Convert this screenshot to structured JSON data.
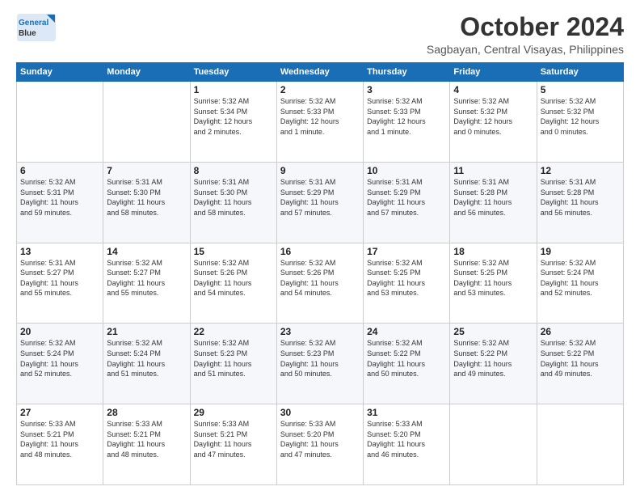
{
  "header": {
    "logo_line1": "General",
    "logo_line2": "Blue",
    "month": "October 2024",
    "location": "Sagbayan, Central Visayas, Philippines"
  },
  "weekdays": [
    "Sunday",
    "Monday",
    "Tuesday",
    "Wednesday",
    "Thursday",
    "Friday",
    "Saturday"
  ],
  "weeks": [
    [
      {
        "day": "",
        "info": ""
      },
      {
        "day": "",
        "info": ""
      },
      {
        "day": "1",
        "info": "Sunrise: 5:32 AM\nSunset: 5:34 PM\nDaylight: 12 hours\nand 2 minutes."
      },
      {
        "day": "2",
        "info": "Sunrise: 5:32 AM\nSunset: 5:33 PM\nDaylight: 12 hours\nand 1 minute."
      },
      {
        "day": "3",
        "info": "Sunrise: 5:32 AM\nSunset: 5:33 PM\nDaylight: 12 hours\nand 1 minute."
      },
      {
        "day": "4",
        "info": "Sunrise: 5:32 AM\nSunset: 5:32 PM\nDaylight: 12 hours\nand 0 minutes."
      },
      {
        "day": "5",
        "info": "Sunrise: 5:32 AM\nSunset: 5:32 PM\nDaylight: 12 hours\nand 0 minutes."
      }
    ],
    [
      {
        "day": "6",
        "info": "Sunrise: 5:32 AM\nSunset: 5:31 PM\nDaylight: 11 hours\nand 59 minutes."
      },
      {
        "day": "7",
        "info": "Sunrise: 5:31 AM\nSunset: 5:30 PM\nDaylight: 11 hours\nand 58 minutes."
      },
      {
        "day": "8",
        "info": "Sunrise: 5:31 AM\nSunset: 5:30 PM\nDaylight: 11 hours\nand 58 minutes."
      },
      {
        "day": "9",
        "info": "Sunrise: 5:31 AM\nSunset: 5:29 PM\nDaylight: 11 hours\nand 57 minutes."
      },
      {
        "day": "10",
        "info": "Sunrise: 5:31 AM\nSunset: 5:29 PM\nDaylight: 11 hours\nand 57 minutes."
      },
      {
        "day": "11",
        "info": "Sunrise: 5:31 AM\nSunset: 5:28 PM\nDaylight: 11 hours\nand 56 minutes."
      },
      {
        "day": "12",
        "info": "Sunrise: 5:31 AM\nSunset: 5:28 PM\nDaylight: 11 hours\nand 56 minutes."
      }
    ],
    [
      {
        "day": "13",
        "info": "Sunrise: 5:31 AM\nSunset: 5:27 PM\nDaylight: 11 hours\nand 55 minutes."
      },
      {
        "day": "14",
        "info": "Sunrise: 5:32 AM\nSunset: 5:27 PM\nDaylight: 11 hours\nand 55 minutes."
      },
      {
        "day": "15",
        "info": "Sunrise: 5:32 AM\nSunset: 5:26 PM\nDaylight: 11 hours\nand 54 minutes."
      },
      {
        "day": "16",
        "info": "Sunrise: 5:32 AM\nSunset: 5:26 PM\nDaylight: 11 hours\nand 54 minutes."
      },
      {
        "day": "17",
        "info": "Sunrise: 5:32 AM\nSunset: 5:25 PM\nDaylight: 11 hours\nand 53 minutes."
      },
      {
        "day": "18",
        "info": "Sunrise: 5:32 AM\nSunset: 5:25 PM\nDaylight: 11 hours\nand 53 minutes."
      },
      {
        "day": "19",
        "info": "Sunrise: 5:32 AM\nSunset: 5:24 PM\nDaylight: 11 hours\nand 52 minutes."
      }
    ],
    [
      {
        "day": "20",
        "info": "Sunrise: 5:32 AM\nSunset: 5:24 PM\nDaylight: 11 hours\nand 52 minutes."
      },
      {
        "day": "21",
        "info": "Sunrise: 5:32 AM\nSunset: 5:24 PM\nDaylight: 11 hours\nand 51 minutes."
      },
      {
        "day": "22",
        "info": "Sunrise: 5:32 AM\nSunset: 5:23 PM\nDaylight: 11 hours\nand 51 minutes."
      },
      {
        "day": "23",
        "info": "Sunrise: 5:32 AM\nSunset: 5:23 PM\nDaylight: 11 hours\nand 50 minutes."
      },
      {
        "day": "24",
        "info": "Sunrise: 5:32 AM\nSunset: 5:22 PM\nDaylight: 11 hours\nand 50 minutes."
      },
      {
        "day": "25",
        "info": "Sunrise: 5:32 AM\nSunset: 5:22 PM\nDaylight: 11 hours\nand 49 minutes."
      },
      {
        "day": "26",
        "info": "Sunrise: 5:32 AM\nSunset: 5:22 PM\nDaylight: 11 hours\nand 49 minutes."
      }
    ],
    [
      {
        "day": "27",
        "info": "Sunrise: 5:33 AM\nSunset: 5:21 PM\nDaylight: 11 hours\nand 48 minutes."
      },
      {
        "day": "28",
        "info": "Sunrise: 5:33 AM\nSunset: 5:21 PM\nDaylight: 11 hours\nand 48 minutes."
      },
      {
        "day": "29",
        "info": "Sunrise: 5:33 AM\nSunset: 5:21 PM\nDaylight: 11 hours\nand 47 minutes."
      },
      {
        "day": "30",
        "info": "Sunrise: 5:33 AM\nSunset: 5:20 PM\nDaylight: 11 hours\nand 47 minutes."
      },
      {
        "day": "31",
        "info": "Sunrise: 5:33 AM\nSunset: 5:20 PM\nDaylight: 11 hours\nand 46 minutes."
      },
      {
        "day": "",
        "info": ""
      },
      {
        "day": "",
        "info": ""
      }
    ]
  ]
}
